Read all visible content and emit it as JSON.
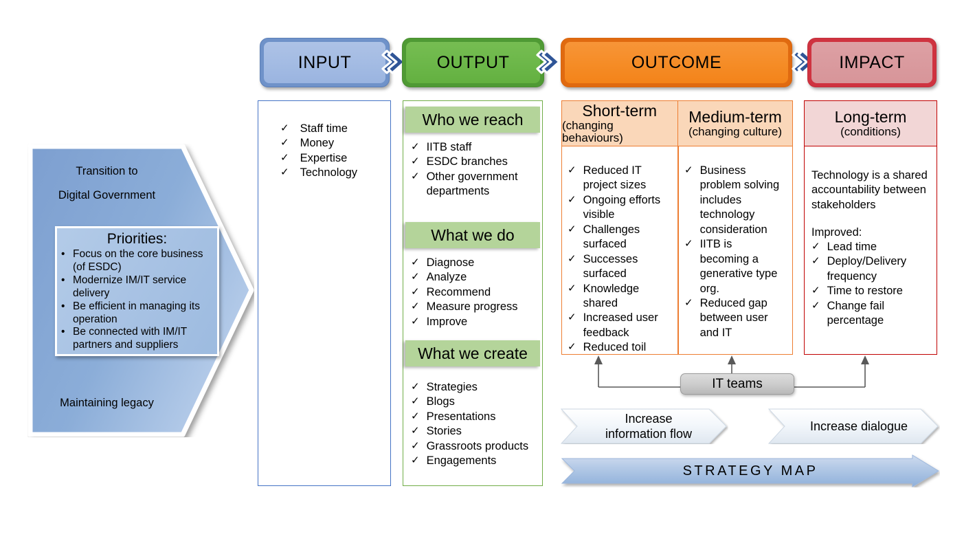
{
  "banners": [
    {
      "key": "input",
      "label": "INPUT"
    },
    {
      "key": "output",
      "label": "OUTPUT"
    },
    {
      "key": "outcome",
      "label": "OUTCOME"
    },
    {
      "key": "impact",
      "label": "IMPACT"
    }
  ],
  "left_arrow": {
    "top_text_line1": "Transition to",
    "top_text_line2": "Digital Government",
    "bottom_text": "Maintaining legacy",
    "priorities": {
      "title": "Priorities:",
      "items": [
        "Focus on the core business (of ESDC)",
        "Modernize IM/IT service delivery",
        "Be efficient in managing its operation",
        "Be connected with IM/IT partners and suppliers"
      ]
    }
  },
  "input_column": {
    "items": [
      "Staff time",
      "Money",
      "Expertise",
      "Technology"
    ]
  },
  "output_column": {
    "sections": [
      {
        "title": "Who we reach",
        "items": [
          "IITB staff",
          "ESDC branches",
          "Other government departments"
        ]
      },
      {
        "title": "What we do",
        "items": [
          "Diagnose",
          "Analyze",
          "Recommend",
          "Measure progress",
          "Improve"
        ]
      },
      {
        "title": "What we create",
        "items": [
          "Strategies",
          "Blogs",
          "Presentations",
          "Stories",
          "Grassroots products",
          "Engagements"
        ]
      }
    ]
  },
  "outcome_column": {
    "short_term": {
      "title": "Short-term",
      "subtitle": "(changing behaviours)",
      "items": [
        "Reduced IT project sizes",
        "Ongoing efforts visible",
        "Challenges surfaced",
        "Successes surfaced",
        "Knowledge shared",
        "Increased user feedback",
        "Reduced toil"
      ]
    },
    "medium_term": {
      "title": "Medium-term",
      "subtitle": "(changing culture)",
      "items": [
        "Business problem solving includes technology consideration",
        "IITB is becoming a generative type org.",
        "Reduced gap between user and IT"
      ]
    }
  },
  "impact_column": {
    "title": "Long-term",
    "subtitle": "(conditions)",
    "statement": "Technology is a shared accountability between stakeholders",
    "improved_label": "Improved:",
    "items": [
      "Lead time",
      "Deploy/Delivery frequency",
      "Time to restore",
      "Change fail percentage"
    ]
  },
  "bottom": {
    "it_teams": "IT teams",
    "flow_left_line1": "Increase",
    "flow_left_line2": "information flow",
    "flow_right": "Increase dialogue",
    "strategy_map": "STRATEGY MAP"
  },
  "colors": {
    "input": "#a3bbe3",
    "output": "#6cb749",
    "outcome": "#f58c26",
    "impact": "#d79599",
    "input_border": "#4472c4",
    "output_border": "#70ad47",
    "outcome_border": "#ed7d31",
    "impact_border": "#c00000",
    "green_bar": "#b4d49a",
    "orange_head": "#fad7b9",
    "red_head": "#f2d6d6",
    "strategy_arrow": "#9dbbe0"
  },
  "checkmark": "✓",
  "bullet": "•"
}
